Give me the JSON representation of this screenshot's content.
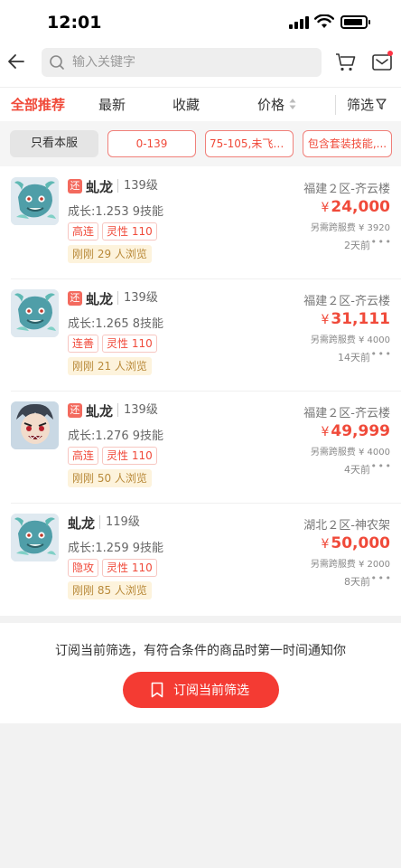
{
  "status_bar": {
    "time": "12:01"
  },
  "search": {
    "placeholder": "输入关键字",
    "value": ""
  },
  "tabs": [
    {
      "label": "全部推荐",
      "active": true
    },
    {
      "label": "最新"
    },
    {
      "label": "收藏"
    },
    {
      "label": "价格"
    },
    {
      "label": "筛选"
    }
  ],
  "chips": [
    {
      "label": "只看本服"
    },
    {
      "label": "0-139"
    },
    {
      "label": "75-105,未飞升..."
    },
    {
      "label": "包含套装技能,..."
    }
  ],
  "items": [
    {
      "badge": "还",
      "name": "虬龙",
      "level": "139级",
      "growth": "成长:1.253 9技能",
      "tags": [
        "高连",
        "灵性 110"
      ],
      "views": "刚刚 29 人浏览",
      "server": "福建２区-齐云楼",
      "currency": "¥",
      "price": "24,000",
      "fee": "另需跨服费 ¥ 3920",
      "time": "2天前",
      "avatar": "dragon"
    },
    {
      "badge": "还",
      "name": "虬龙",
      "level": "139级",
      "growth": "成长:1.265 8技能",
      "tags": [
        "连善",
        "灵性 110"
      ],
      "views": "刚刚 21 人浏览",
      "server": "福建２区-齐云楼",
      "currency": "¥",
      "price": "31,111",
      "fee": "另需跨服费 ¥ 4000",
      "time": "14天前",
      "avatar": "dragon"
    },
    {
      "badge": "还",
      "name": "虬龙",
      "level": "139级",
      "growth": "成长:1.276 9技能",
      "tags": [
        "高连",
        "灵性 110"
      ],
      "views": "刚刚 50 人浏览",
      "server": "福建２区-齐云楼",
      "currency": "¥",
      "price": "49,999",
      "fee": "另需跨服费 ¥ 4000",
      "time": "4天前",
      "avatar": "face"
    },
    {
      "badge": "",
      "name": "虬龙",
      "level": "119级",
      "growth": "成长:1.259 9技能",
      "tags": [
        "隐攻",
        "灵性 110"
      ],
      "views": "刚刚 85 人浏览",
      "server": "湖北２区-神农架",
      "currency": "¥",
      "price": "50,000",
      "fee": "另需跨服费 ¥ 2000",
      "time": "8天前",
      "avatar": "dragon"
    }
  ],
  "subscribe": {
    "text": "订阅当前筛选，有符合条件的商品时第一时间通知你",
    "button": "订阅当前筛选"
  },
  "colors": {
    "accent": "#f04a3a",
    "button": "#f43b33"
  }
}
